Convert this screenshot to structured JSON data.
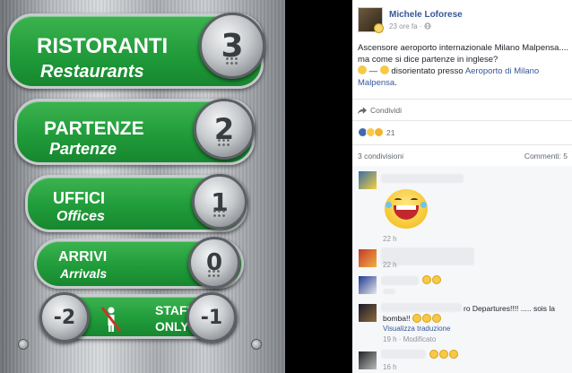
{
  "photo": {
    "buttons": [
      {
        "it": "RISTORANTI",
        "en": "Restaurants",
        "floor": "3"
      },
      {
        "it": "PARTENZE",
        "en": "Partenze",
        "floor": "2"
      },
      {
        "it": "UFFICI",
        "en": "Offices",
        "floor": "1"
      },
      {
        "it": "ARRIVI",
        "en": "Arrivals",
        "floor": "0"
      }
    ],
    "staff": {
      "line1": "STAFF",
      "line2": "ONLY",
      "left_floor": "-2",
      "right_floor": "-1"
    },
    "colors": {
      "plate": "#1f9a39",
      "metal": "#b7bbbf"
    }
  },
  "post": {
    "author": "Michele Loforese",
    "meta": "23 ore fa · ",
    "text_main": "Ascensore aeroporto internazionale Milano Malpensa.... ma come si dice partenze in inglese?",
    "text_feeling": " — ",
    "text_feeling_tail": " disorientato presso ",
    "place_link": "Aeroporto di Milano Malpensa",
    "text_end": ".",
    "share_label": "Condividi",
    "reactions_count": "21",
    "shares_label": "3 condivisioni",
    "comments_label": "Commenti: 5"
  },
  "comments": [
    {
      "time": "22 h"
    },
    {
      "time": "22 h"
    },
    {
      "time": ""
    },
    {
      "text_a": "ro Departures!!!! ..... sois la",
      "text_b": "bomba!!",
      "link": "Visualizza traduzione",
      "time": "19 h · Modificato"
    },
    {
      "time": "16 h"
    }
  ],
  "icons": {
    "share": "share-icon",
    "like": "like-reaction-icon",
    "haha": "haha-reaction-icon",
    "wow": "wow-reaction-icon",
    "globe": "globe-icon"
  }
}
